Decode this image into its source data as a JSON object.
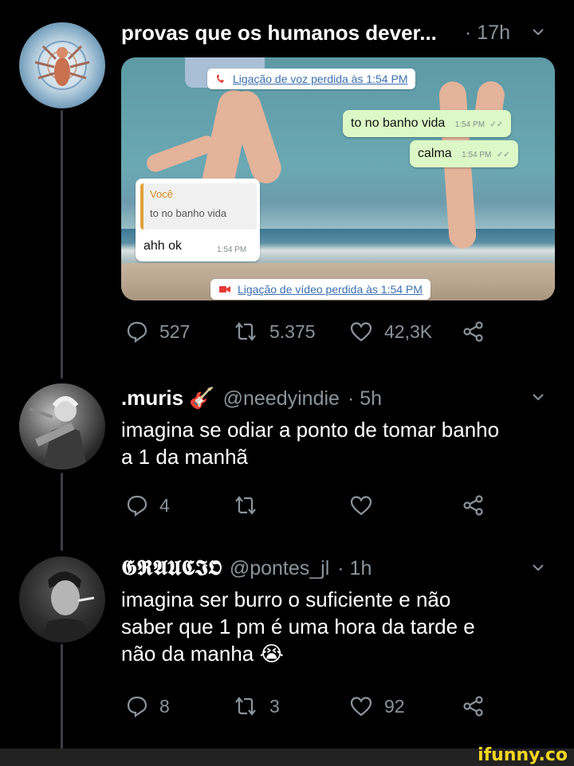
{
  "tweet1": {
    "name": "provas que os humanos dever...",
    "time": "· 17h",
    "media": {
      "missed_voice": "Ligação de voz perdida às 1:54 PM",
      "msg1_text": "to no banho vida",
      "msg1_time": "1:54 PM",
      "msg2_text": "calma",
      "msg2_time": "1:54 PM",
      "quote_author": "Você",
      "quote_text": "to no banho vida",
      "reply_text": "ahh ok",
      "reply_time": "1:54 PM",
      "missed_video": "Ligação de vídeo perdida às 1:54 PM"
    },
    "replies": "527",
    "retweets": "5.375",
    "likes": "42,3K"
  },
  "tweet2": {
    "name": ".muris 🎸",
    "handle": "@needyindie",
    "time": "· 5h",
    "text_line1": "imagina se odiar a ponto de tomar banho",
    "text_line2": "a 1 da manhã",
    "replies": "4",
    "retweets": "",
    "likes": ""
  },
  "tweet3": {
    "name": "𝕲𝕽𝕬𝖀𝕮𝕴𝕺",
    "handle": "@pontes_jl",
    "time": "· 1h",
    "text_line1": "imagina ser burro o suficiente e não",
    "text_line2": "saber que 1 pm é uma hora da tarde e",
    "text_line3": "não da manha 😭",
    "replies": "8",
    "retweets": "3",
    "likes": "92"
  },
  "watermark": "ifunny.co",
  "colors": {
    "background": "#000000",
    "muted": "#8a949c",
    "thread_line": "#3a3f45",
    "watermark": "#f6d51f"
  }
}
